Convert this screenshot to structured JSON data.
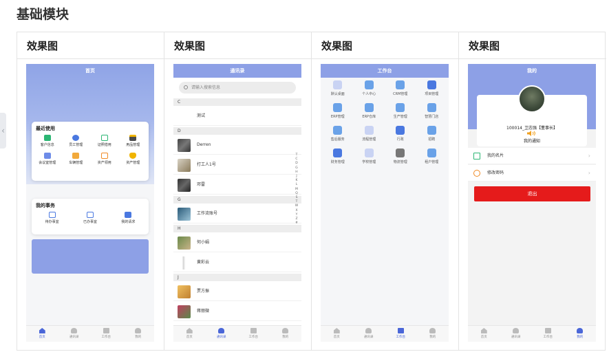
{
  "section_title": "基础模块",
  "columns": [
    {
      "header": "效果图"
    },
    {
      "header": "效果图"
    },
    {
      "header": "效果图"
    },
    {
      "header": "效果图"
    }
  ],
  "tabbar": [
    "首页",
    "通讯录",
    "工作台",
    "我的"
  ],
  "home": {
    "title": "首页",
    "recent_title": "最近使用",
    "recent_items": [
      "客户信息",
      "员工管理",
      "证照借用",
      "用品管理",
      "会议室管理",
      "车辆管理",
      "资产领用",
      "资产管理"
    ],
    "affairs_title": "我的事务",
    "affairs_items": [
      "待办事宜",
      "已办事宜",
      "我的请求"
    ]
  },
  "contacts": {
    "title": "通讯录",
    "search_placeholder": "请输入搜索信息",
    "groups": [
      {
        "letter": "C",
        "names": [
          "测试"
        ]
      },
      {
        "letter": "D",
        "names": [
          "Derren",
          "打工人1号",
          "邓雷"
        ]
      },
      {
        "letter": "G",
        "names": [
          "工作流账号"
        ]
      },
      {
        "letter": "H",
        "names": [
          "何小娟",
          "黄彩云"
        ]
      },
      {
        "letter": "J",
        "names": [
          "贾方振",
          "蒋丽微"
        ]
      }
    ],
    "index_letters": [
      "T",
      "C",
      "D",
      "G",
      "H",
      "J",
      "K",
      "L",
      "M",
      "Q",
      "S",
      "T",
      "W",
      "X",
      "Y",
      "Z",
      "#"
    ]
  },
  "workbench": {
    "title": "工作台",
    "items": [
      "默认桌面",
      "个人中心",
      "CRM管理",
      "项目管理",
      "ERP管理",
      "ERP仓库",
      "生产管理",
      "智慧门店",
      "售后服务",
      "流程管理",
      "行政",
      "招聘",
      "财务管理",
      "学校管理",
      "物流管理",
      "租户管理"
    ]
  },
  "mine": {
    "title": "我的",
    "user_line": "100014_卫志强【董事长】",
    "notice": "我的通知",
    "menu": [
      "我的名片",
      "修改密码"
    ],
    "logout": "退出"
  },
  "colors": {
    "brand": "#8da0e6",
    "tab_active": "#4a66d8",
    "logout": "#e51b1b"
  }
}
